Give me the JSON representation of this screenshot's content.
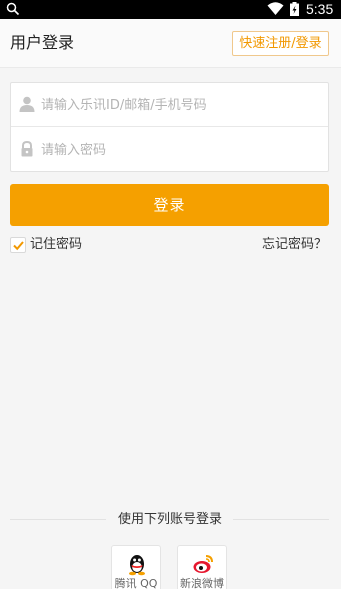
{
  "status_bar": {
    "time": "5:35",
    "icons": [
      "search-icon",
      "wifi-icon",
      "battery-icon"
    ]
  },
  "header": {
    "title": "用户登录",
    "register_label": "快速注册/登录"
  },
  "form": {
    "account_placeholder": "请输入乐讯ID/邮箱/手机号码",
    "account_value": "",
    "password_placeholder": "请输入密码",
    "password_value": "",
    "account_icon": "user-icon",
    "password_icon": "lock-icon"
  },
  "login_button": "登录",
  "remember": {
    "label": "记住密码",
    "checked": true
  },
  "forgot_label": "忘记密码？",
  "third_party": {
    "title": "使用下列账号登录",
    "providers": [
      {
        "label": "腾讯 QQ",
        "icon": "qq-icon"
      },
      {
        "label": "新浪微博",
        "icon": "weibo-icon"
      }
    ]
  },
  "colors": {
    "accent": "#f5a000",
    "register_text": "#f29800",
    "background": "#f5f5f5"
  }
}
